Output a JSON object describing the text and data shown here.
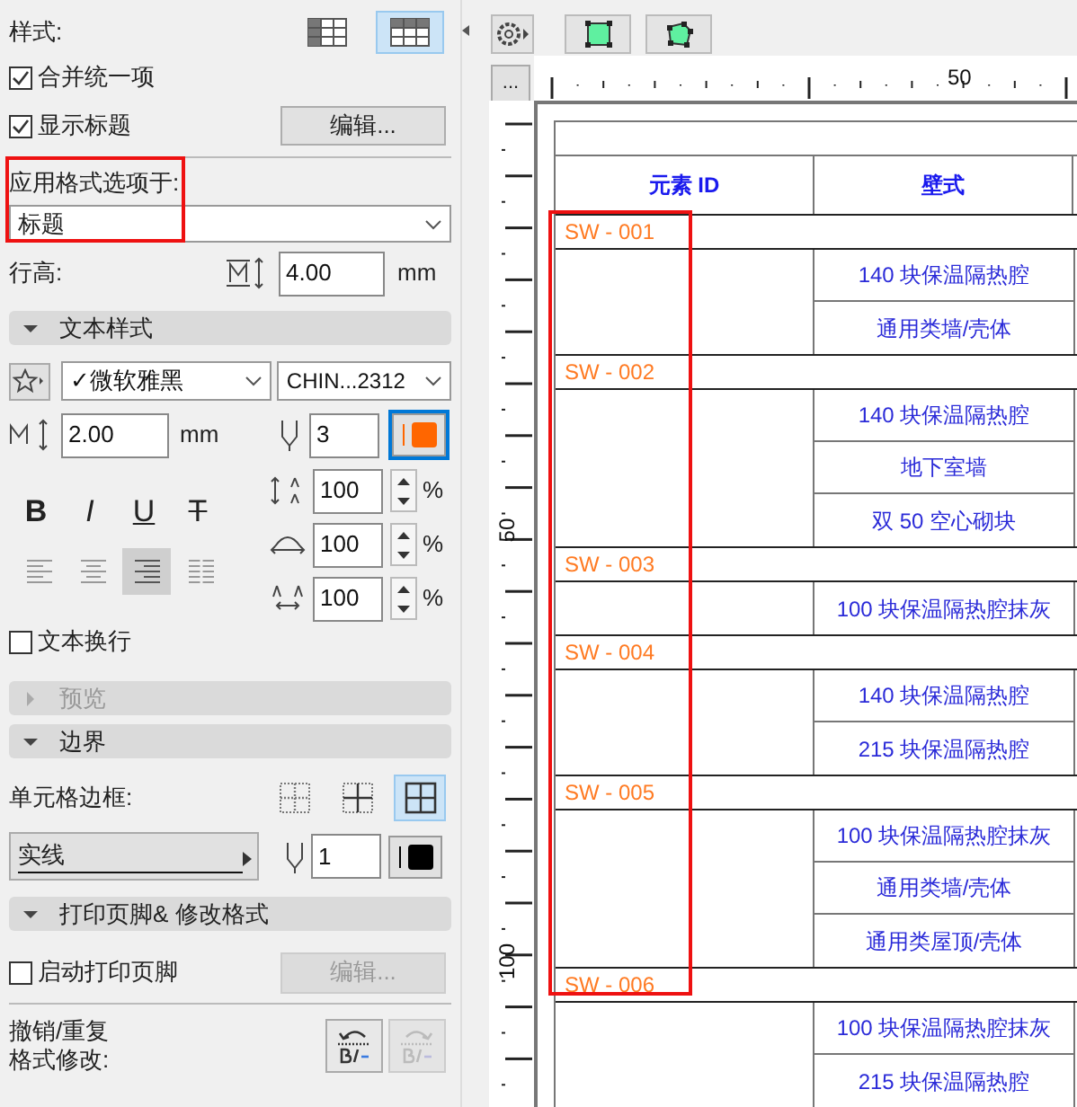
{
  "left_panel": {
    "style": {
      "label": "样式:",
      "options": [
        {
          "selected": false
        },
        {
          "selected": true
        }
      ]
    },
    "checkboxes": [
      {
        "label": "合并统一项",
        "checked": true
      },
      {
        "label": "显示标题",
        "checked": true
      }
    ],
    "edit_button": {
      "label": "编辑...",
      "disabled": false
    },
    "apply_format": {
      "label": "应用格式选项于:",
      "value": "标题",
      "highlighted": true
    },
    "row_height": {
      "label": "行高:",
      "value": "4.00",
      "unit": "mm"
    },
    "text_style": {
      "title": "文本样式",
      "expanded": true,
      "font": "✓微软雅黑",
      "encoding": "CHIN...2312",
      "size": "2.00",
      "size_unit": "mm",
      "pen": {
        "value": "3",
        "color": "#ff6600"
      },
      "scales": [
        {
          "kind": "line-spacing",
          "value": "100",
          "unit": "%"
        },
        {
          "kind": "width",
          "value": "100",
          "unit": "%"
        },
        {
          "kind": "spacing",
          "value": "100",
          "unit": "%"
        }
      ],
      "styles": [
        {
          "kind": "bold",
          "label": "B"
        },
        {
          "kind": "italic",
          "label": "I"
        },
        {
          "kind": "underline",
          "label": "U"
        },
        {
          "kind": "strike",
          "label": "T"
        }
      ],
      "alignments": [
        {
          "kind": "left",
          "selected": false
        },
        {
          "kind": "center",
          "selected": false
        },
        {
          "kind": "right",
          "selected": true
        },
        {
          "kind": "justify",
          "selected": false
        }
      ],
      "wrap": {
        "label": "文本换行",
        "checked": false
      }
    },
    "preview": {
      "title": "预览",
      "expanded": false,
      "disabled": true
    },
    "borders": {
      "title": "边界",
      "expanded": true,
      "label": "单元格边框:",
      "options": [
        {
          "kind": "none",
          "selected": false
        },
        {
          "kind": "inner",
          "selected": false
        },
        {
          "kind": "all",
          "selected": true
        }
      ],
      "line_type": "实线",
      "pen": {
        "value": "1",
        "color": "#000000"
      }
    },
    "footer": {
      "title": "打印页脚& 修改格式",
      "expanded": true,
      "checkbox": {
        "label": "启动打印页脚",
        "checked": false
      },
      "edit_button": {
        "label": "编辑...",
        "disabled": true
      },
      "undo_label": [
        "撤销/重复",
        "格式修改:"
      ],
      "undo": {
        "disabled": false
      },
      "redo": {
        "disabled": true
      }
    }
  },
  "ruler": {
    "button": "...",
    "top_labels": [
      "50"
    ],
    "left_labels": [
      "50",
      "100"
    ]
  },
  "table": {
    "columns": [
      "元素 ID",
      "壁式"
    ],
    "id_column_highlighted": true,
    "groups": [
      {
        "id": "SW - 001",
        "items": [
          "140 块保温隔热腔",
          "通用类墙/壳体"
        ]
      },
      {
        "id": "SW - 002",
        "items": [
          "140 块保温隔热腔",
          "地下室墙",
          "双 50 空心砌块"
        ]
      },
      {
        "id": "SW - 003",
        "items": [
          "100 块保温隔热腔抹灰"
        ]
      },
      {
        "id": "SW - 004",
        "items": [
          "140 块保温隔热腔",
          "215 块保温隔热腔"
        ]
      },
      {
        "id": "SW - 005",
        "items": [
          "100 块保温隔热腔抹灰",
          "通用类墙/壳体",
          "通用类屋顶/壳体"
        ]
      },
      {
        "id": "SW - 006",
        "items": [
          "100 块保温隔热腔抹灰",
          "215 块保温隔热腔"
        ]
      }
    ]
  }
}
